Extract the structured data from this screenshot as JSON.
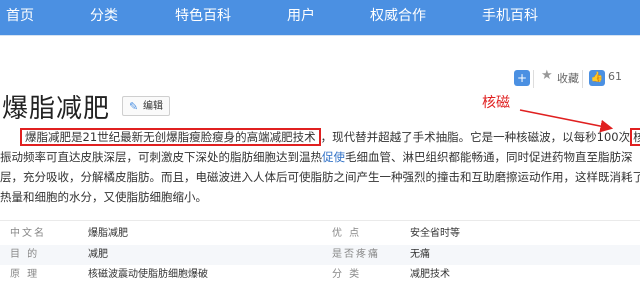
{
  "nav": {
    "items": [
      "首页",
      "分类",
      "特色百科",
      "用户",
      "权威合作",
      "手机百科"
    ]
  },
  "toolbar": {
    "add_icon": "plus-square-icon",
    "star_icon": "star-icon",
    "collect_label": "收藏",
    "like_icon": "thumbs-up-icon",
    "like_count": "61"
  },
  "article": {
    "title": "爆脂减肥",
    "edit_label": "编辑",
    "annotation_label": "核磁",
    "para": {
      "l1_highlight": "爆脂减肥是21世纪最新无创爆脂瘦脸瘦身的高端减肥技术",
      "l1_rest": "，现代替并超越了手术抽脂。它是一种核磁波，以每秒100次",
      "l1_box": "核滋",
      "l2_a": "振动频率可直达皮肤深层，可刺激皮下深处的脂肪细胞达到温热",
      "l2_link": "促使",
      "l2_b": "毛细血管、淋巴组织都能畅通，同时促进药物直至脂肪深",
      "l3": "层，充分吸收，分解橘皮脂肪。而且，电磁波进入人体后可使脂肪之间产生一种强烈的撞击和互助磨擦运动作用，这样既消耗了",
      "l4": "热量和细胞的水分，又使脂肪细胞缩小。"
    }
  },
  "infobox": {
    "rows": [
      {
        "k1": "中文名",
        "v1": "爆脂减肥",
        "k2": "优 点",
        "v2": "安全省时等"
      },
      {
        "k1": "目 的",
        "v1": "减肥",
        "k2": "是否疼痛",
        "v2": "无痛"
      },
      {
        "k1": "原 理",
        "v1": "核磁波震动使脂肪细胞爆破",
        "k2": "分 类",
        "v2": "减肥技术"
      }
    ]
  },
  "colors": {
    "nav_bg": "#4b90e2",
    "annotation": "#e02020",
    "link": "#2d6fc6"
  }
}
